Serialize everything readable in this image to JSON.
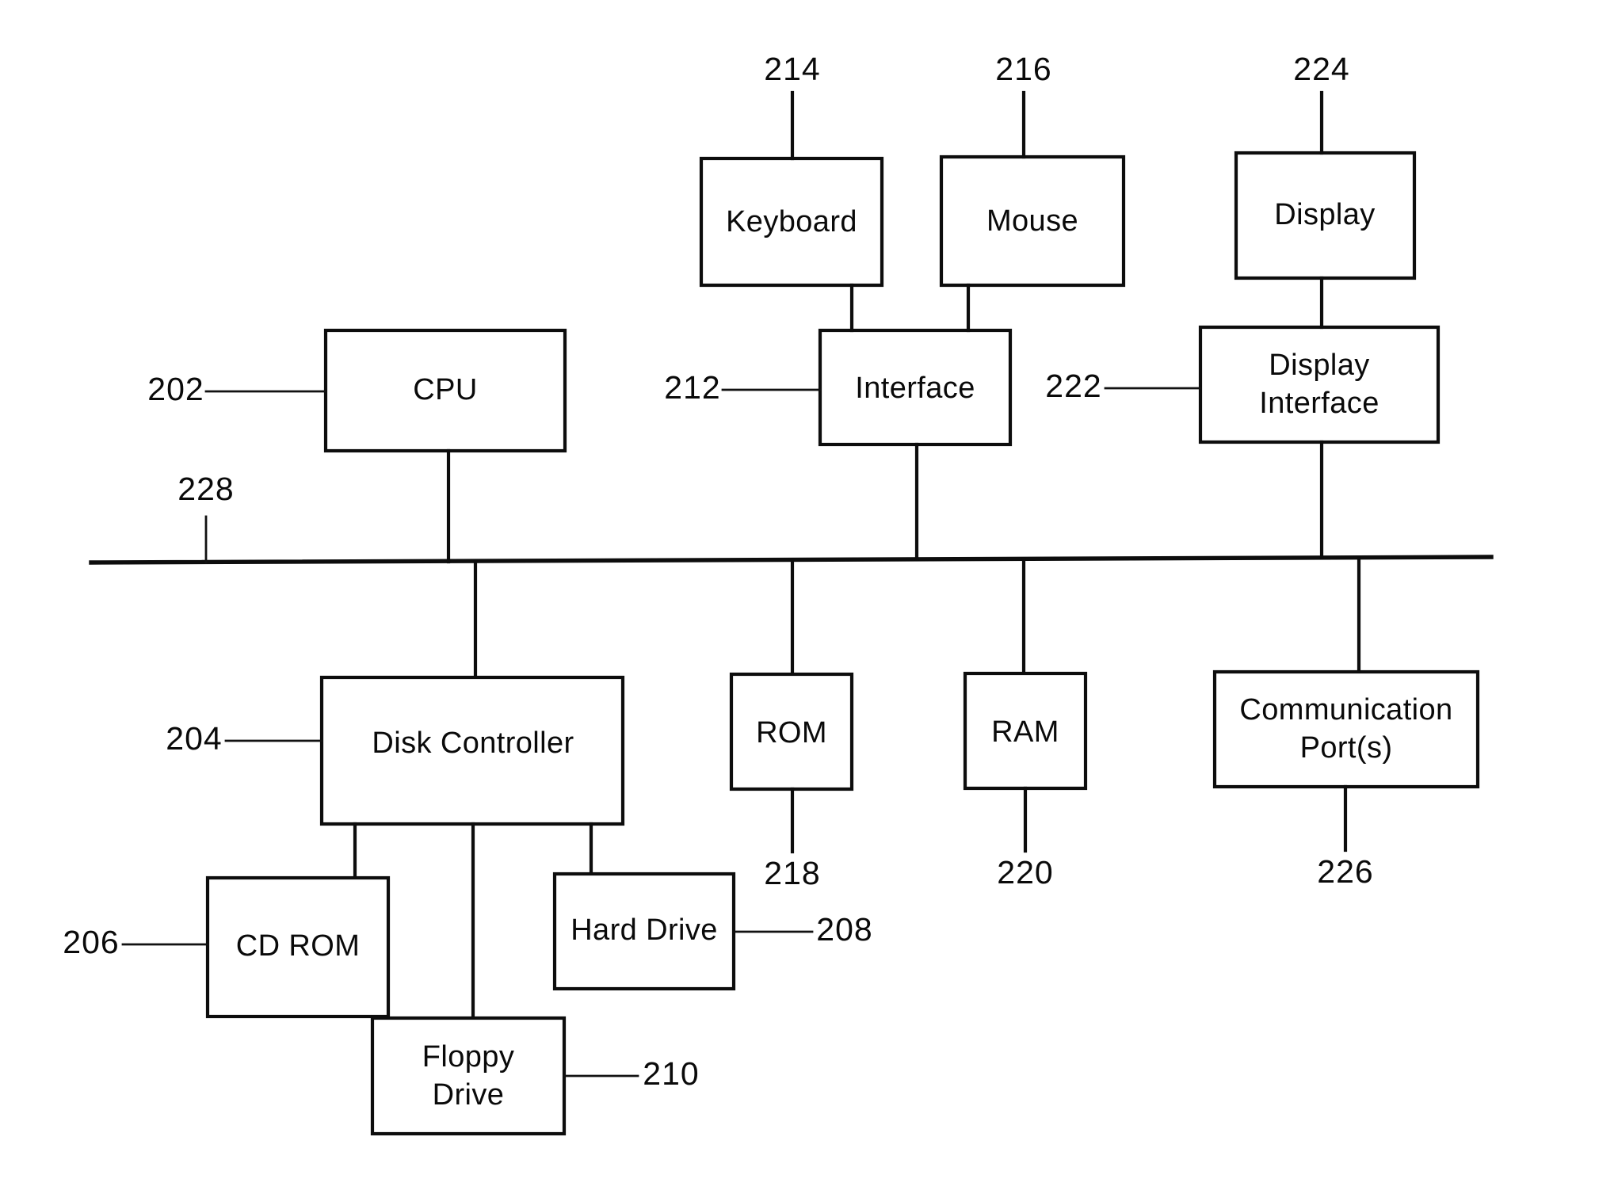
{
  "figure": {
    "kind": "patent-block-diagram",
    "subject": "Computer system architecture block diagram",
    "background_color": "#ffffff",
    "ink_color": "#0d0d0d"
  },
  "nodes": {
    "keyboard": {
      "label": "Keyboard",
      "ref": "214"
    },
    "mouse": {
      "label": "Mouse",
      "ref": "216"
    },
    "display": {
      "label": "Display",
      "ref": "224"
    },
    "cpu": {
      "label": "CPU",
      "ref": "202"
    },
    "interface": {
      "label": "Interface",
      "ref": "212"
    },
    "display_interface": {
      "label_line1": "Display",
      "label_line2": "Interface",
      "ref": "222"
    },
    "disk_controller": {
      "label": "Disk Controller",
      "ref": "204"
    },
    "rom": {
      "label": "ROM",
      "ref": "218"
    },
    "ram": {
      "label": "RAM",
      "ref": "220"
    },
    "communication_ports": {
      "label_line1": "Communication",
      "label_line2": "Port(s)",
      "ref": "226"
    },
    "cd_rom": {
      "label": "CD ROM",
      "ref": "206"
    },
    "hard_drive": {
      "label": "Hard Drive",
      "ref": "208"
    },
    "floppy_drive": {
      "label_line1": "Floppy",
      "label_line2": "Drive",
      "ref": "210"
    },
    "bus": {
      "ref": "228"
    }
  },
  "reference_numerals": [
    "202",
    "204",
    "206",
    "208",
    "210",
    "212",
    "214",
    "216",
    "218",
    "220",
    "222",
    "224",
    "226",
    "228"
  ]
}
